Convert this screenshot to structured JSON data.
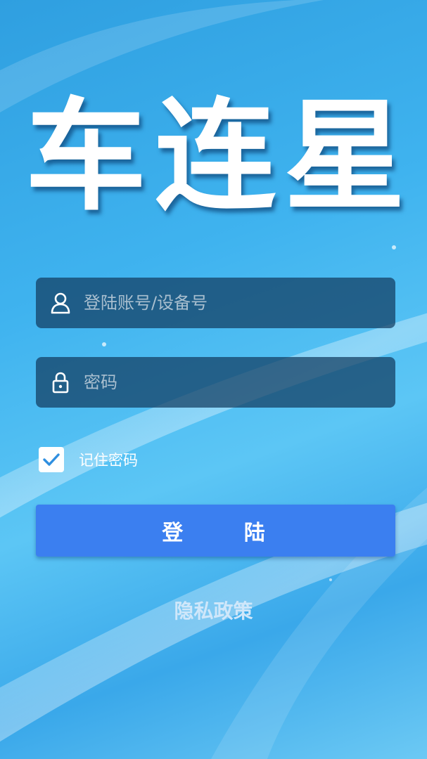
{
  "logo": {
    "chars": [
      "车",
      "连",
      "星"
    ]
  },
  "login_form": {
    "account_placeholder": "登陆账号/设备号",
    "password_placeholder": "密码",
    "remember_label": "记住密码",
    "remember_checked": true,
    "login_button": "登  陆"
  },
  "footer": {
    "privacy_link": "隐私政策"
  },
  "icons": {
    "account": "user-icon",
    "password": "lock-icon",
    "checkbox": "checkmark-icon"
  },
  "colors": {
    "primary_button": "#3b7ff0",
    "checkmark": "#2f8fe0",
    "field_bg": "#123c5f"
  }
}
